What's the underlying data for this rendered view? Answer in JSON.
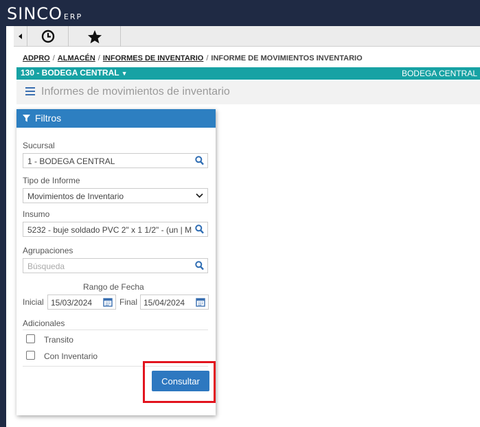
{
  "app": {
    "logo_main": "SINCO",
    "logo_suffix": "ERP"
  },
  "breadcrumb": {
    "items": [
      "ADPRO",
      "ALMACÉN",
      "INFORMES DE INVENTARIO"
    ],
    "current": "INFORME DE MOVIMIENTOS INVENTARIO",
    "separator": "/"
  },
  "branch_bar": {
    "selector_label": "130 - BODEGA CENTRAL",
    "right_label": "BODEGA CENTRAL"
  },
  "page": {
    "title": "Informes de movimientos de inventario"
  },
  "filters": {
    "title": "Filtros",
    "sucursal": {
      "label": "Sucursal",
      "value": "1 - BODEGA CENTRAL"
    },
    "tipo_informe": {
      "label": "Tipo de Informe",
      "value": "Movimientos de Inventario"
    },
    "insumo": {
      "label": "Insumo",
      "value": "5232 - buje soldado PVC 2\" x 1 1/2\" - (un | M"
    },
    "agrupaciones": {
      "label": "Agrupaciones",
      "placeholder": "Búsqueda"
    },
    "rango_fecha": {
      "label": "Rango de Fecha",
      "inicial_label": "Inicial",
      "inicial_value": "15/03/2024",
      "final_label": "Final",
      "final_value": "15/04/2024"
    },
    "adicionales": {
      "label": "Adicionales",
      "options": [
        {
          "label": "Transito",
          "checked": false
        },
        {
          "label": "Con Inventario",
          "checked": false
        }
      ]
    },
    "submit_label": "Consultar"
  },
  "colors": {
    "header_bg": "#1f2a44",
    "teal": "#17a2a4",
    "panel_header": "#2d7fc1",
    "button": "#2e78c0",
    "highlight": "#e2141e"
  },
  "icons": [
    "clock-icon",
    "star-icon",
    "funnel-icon",
    "search-icon",
    "chevron-down-icon",
    "calendar-icon",
    "menu-icon"
  ]
}
